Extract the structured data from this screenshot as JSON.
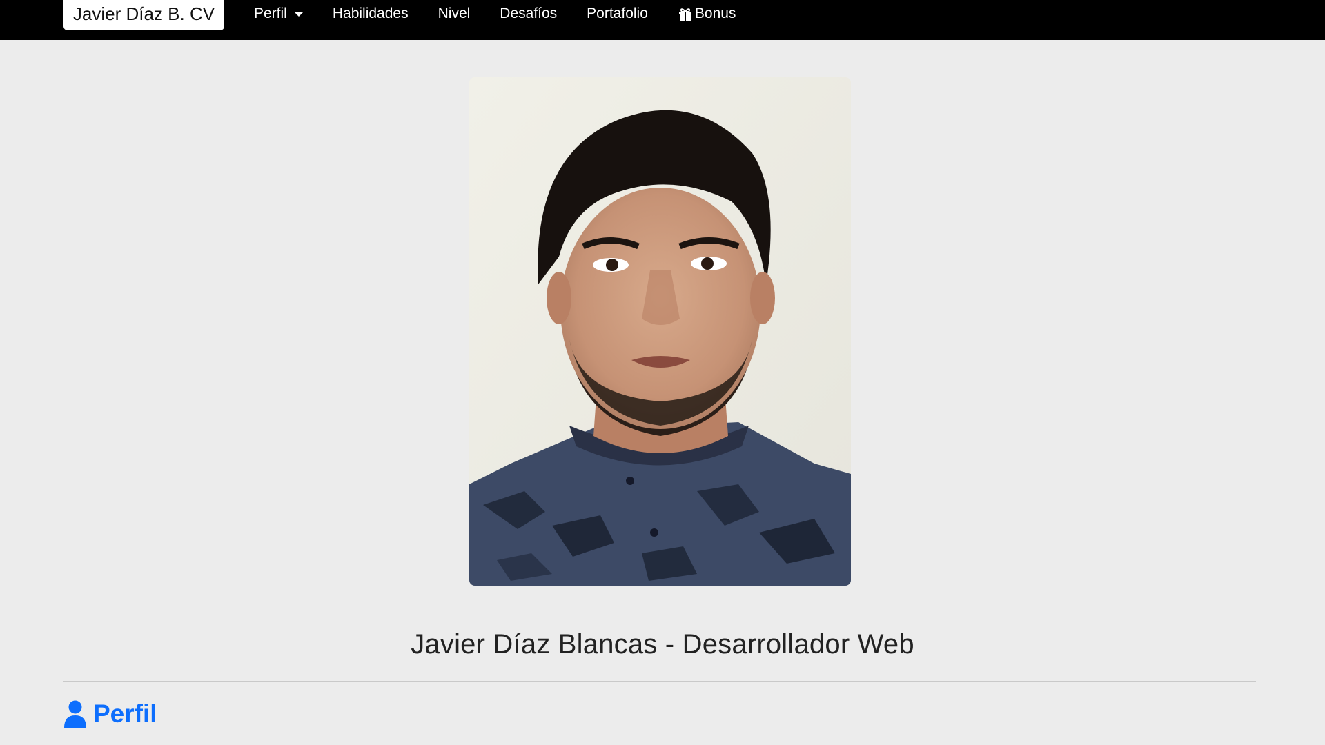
{
  "nav": {
    "brand": "Javier Díaz B. CV",
    "items": [
      {
        "label": "Perfil",
        "icon": null,
        "dropdown": true
      },
      {
        "label": "Habilidades",
        "icon": null,
        "dropdown": false
      },
      {
        "label": "Nivel",
        "icon": null,
        "dropdown": false
      },
      {
        "label": "Desafíos",
        "icon": null,
        "dropdown": false
      },
      {
        "label": "Portafolio",
        "icon": null,
        "dropdown": false
      },
      {
        "label": "Bonus",
        "icon": "gift-icon",
        "dropdown": false
      }
    ]
  },
  "hero": {
    "photo_icon": "profile-photo",
    "headline": "Javier Díaz Blancas - Desarrollador Web"
  },
  "section": {
    "icon": "person-icon",
    "title": "Perfil"
  },
  "colors": {
    "navbar_bg": "#000000",
    "page_bg": "#ececec",
    "accent": "#0d6efd",
    "headline_text": "#222222"
  }
}
